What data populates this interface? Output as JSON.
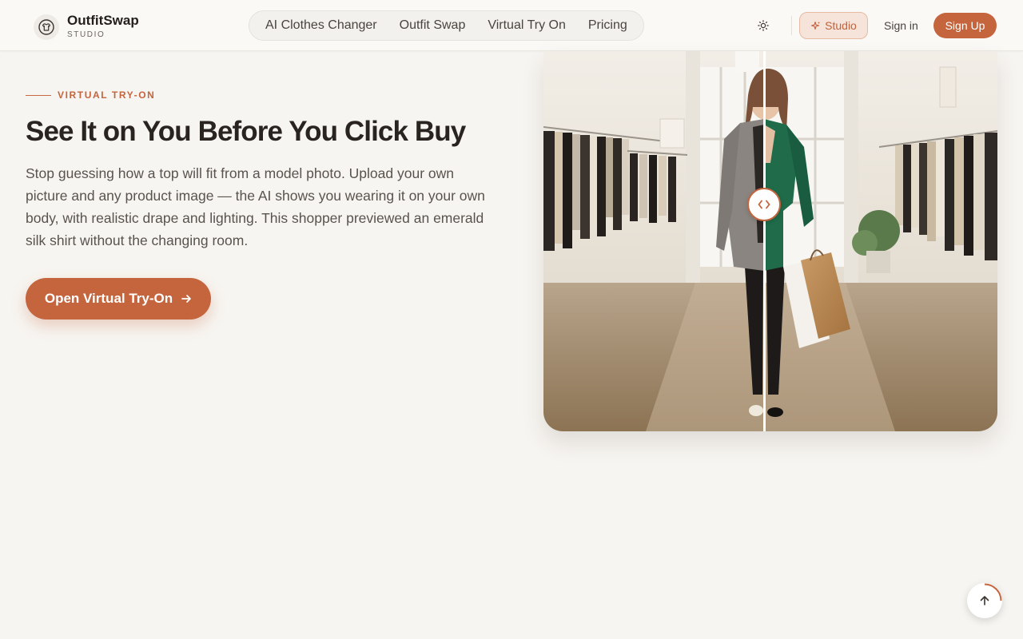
{
  "brand": {
    "name": "OutfitSwap",
    "sub": "STUDIO",
    "icon": "tshirt-icon"
  },
  "nav": {
    "items": [
      {
        "label": "AI Clothes Changer"
      },
      {
        "label": "Outfit Swap"
      },
      {
        "label": "Virtual Try On"
      },
      {
        "label": "Pricing"
      }
    ]
  },
  "header_actions": {
    "theme_icon": "sun-icon",
    "studio_label": "Studio",
    "studio_icon": "sparkles-icon",
    "signin_label": "Sign in",
    "signup_label": "Sign Up"
  },
  "hero": {
    "eyebrow": "VIRTUAL TRY-ON",
    "title": "See It on You Before You Click Buy",
    "description": "Stop guessing how a top will fit from a model photo. Upload your own picture and any product image — the AI shows you wearing it on your own body, with realistic drape and lighting. This shopper previewed an emerald silk shirt without the changing room.",
    "cta_label": "Open Virtual Try-On",
    "cta_icon": "arrow-right-icon"
  },
  "compare": {
    "handle_icon": "chevrons-left-right-icon",
    "position_fraction": 0.487
  },
  "back_to_top": {
    "icon": "arrow-up-icon"
  },
  "colors": {
    "accent": "#c4653e",
    "background": "#f7f5f1",
    "text_dark": "#2a2421",
    "shirt_after": "#1f6b4a",
    "cardigan_before": "#8a8580"
  }
}
